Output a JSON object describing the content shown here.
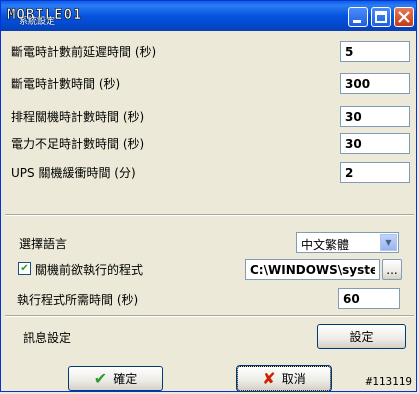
{
  "window": {
    "title_logo": "MOBILE01",
    "title_sub": "系統設定"
  },
  "timers": [
    {
      "label": "斷電時計數前延遲時間 (秒)",
      "value": "5"
    },
    {
      "label": "斷電時計數時間 (秒)",
      "value": "300"
    },
    {
      "label": "排程關機時計數時間 (秒)",
      "value": "30"
    },
    {
      "label": "電力不足時計數時間 (秒)",
      "value": "30"
    },
    {
      "label": "UPS 關機緩衝時間 (分)",
      "value": "2"
    }
  ],
  "language": {
    "label": "選擇語言",
    "selected": "中文繁體"
  },
  "pre_shutdown": {
    "label": "關機前欲執行的程式",
    "checked": true,
    "path": "C:\\WINDOWS\\syste",
    "browse_label": "..."
  },
  "exec_time": {
    "label": "執行程式所需時間 (秒)",
    "value": "60"
  },
  "message": {
    "label": "訊息設定",
    "button_label": "設定"
  },
  "buttons": {
    "ok": "確定",
    "cancel": "取消"
  },
  "watermark": "#113119"
}
